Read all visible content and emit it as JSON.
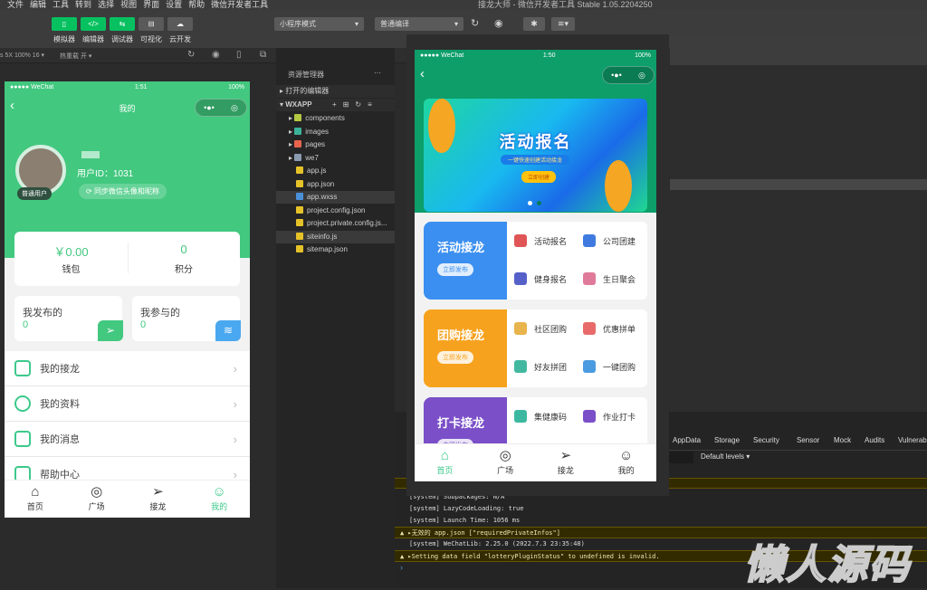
{
  "menubar": {
    "items": [
      "文件",
      "编辑",
      "工具",
      "转到",
      "选择",
      "视图",
      "界面",
      "设置",
      "帮助",
      "微信开发者工具"
    ],
    "title": "接龙大师 - 微信开发者工具 Stable 1.05.2204250"
  },
  "toolbar": {
    "buttons": [
      {
        "label": "模拟器",
        "glyph": "▯"
      },
      {
        "label": "编辑器",
        "glyph": "</>"
      },
      {
        "label": "调试器",
        "glyph": "⇆"
      },
      {
        "label": "可视化",
        "glyph": "⊟"
      },
      {
        "label": "云开发",
        "glyph": "☁"
      }
    ],
    "mode": "小程序模式",
    "compile": "普通编译"
  },
  "simbar": {
    "device": "s 5X 100% 16 ▾",
    "hotreload": "热重载 开 ▾"
  },
  "left_phone": {
    "status": {
      "carrier": "●●●●● WeChat",
      "time": "1:51",
      "battery": "100%"
    },
    "title": "我的",
    "capsule_more": "•●•",
    "capsule_close": "◎",
    "user_id": "用户ID：1031",
    "badge": "普通用户",
    "sync": "同步微信头像和昵称",
    "wallet_value": "￥0.00",
    "wallet_label": "钱包",
    "points_value": "0",
    "points_label": "积分",
    "published_label": "我发布的",
    "published_value": "0",
    "joined_label": "我参与的",
    "joined_value": "0",
    "menu": [
      {
        "label": "我的接龙"
      },
      {
        "label": "我的资料"
      },
      {
        "label": "我的消息"
      },
      {
        "label": "帮助中心"
      }
    ],
    "tabs": [
      {
        "label": "首页",
        "icon": "⌂"
      },
      {
        "label": "广场",
        "icon": "◎"
      },
      {
        "label": "接龙",
        "icon": "➢"
      },
      {
        "label": "我的",
        "icon": "☺"
      }
    ]
  },
  "explorer": {
    "title": "资源管理器",
    "more": "···",
    "open_editors": "打开的编辑器",
    "project": "WXAPP",
    "files": [
      {
        "name": "components",
        "type": "folder",
        "color": "#b5c842"
      },
      {
        "name": "images",
        "type": "folder",
        "color": "#3bb39a"
      },
      {
        "name": "pages",
        "type": "folder",
        "color": "#e8644c"
      },
      {
        "name": "we7",
        "type": "folder",
        "color": "#8a9bb0"
      },
      {
        "name": "app.js",
        "type": "js",
        "color": "#e6c229"
      },
      {
        "name": "app.json",
        "type": "json",
        "color": "#e6c229"
      },
      {
        "name": "app.wxss",
        "type": "css",
        "color": "#4a90d9"
      },
      {
        "name": "project.config.json",
        "type": "json",
        "color": "#e6c229"
      },
      {
        "name": "project.private.config.js...",
        "type": "json",
        "color": "#e6c229"
      },
      {
        "name": "siteinfo.js",
        "type": "js",
        "color": "#e6c229"
      },
      {
        "name": "sitemap.json",
        "type": "json",
        "color": "#e6c229"
      }
    ]
  },
  "right_phone": {
    "status": {
      "carrier": "●●●●● WeChat",
      "time": "1:50",
      "battery": "100%"
    },
    "capsule_more": "•●•",
    "capsule_close": "◎",
    "banner": {
      "title": "活动报名",
      "subtitle": "一键快速创建活动接龙",
      "button": "立即创建"
    },
    "sections": [
      {
        "title": "活动接龙",
        "button": "立即发布",
        "color": "#3b8ff0",
        "items": [
          {
            "label": "活动报名",
            "color": "#e05555"
          },
          {
            "label": "公司团建",
            "color": "#3f7ae0"
          },
          {
            "label": "健身报名",
            "color": "#5561c8"
          },
          {
            "label": "生日聚会",
            "color": "#e07a9a"
          }
        ]
      },
      {
        "title": "团购接龙",
        "button": "立即发布",
        "color": "#f7a21e",
        "items": [
          {
            "label": "社区团购",
            "color": "#e8b44c"
          },
          {
            "label": "优惠拼单",
            "color": "#e86a6a"
          },
          {
            "label": "好友拼团",
            "color": "#43b8a0"
          },
          {
            "label": "一键团购",
            "color": "#4a9be0"
          }
        ]
      },
      {
        "title": "打卡接龙",
        "button": "立即发布",
        "color": "#7a4fc8",
        "items": [
          {
            "label": "集健康码",
            "color": "#3cb8a0"
          },
          {
            "label": "作业打卡",
            "color": "#7a4fc8"
          }
        ]
      }
    ],
    "tabs": [
      {
        "label": "首页",
        "icon": "⌂"
      },
      {
        "label": "广场",
        "icon": "◎"
      },
      {
        "label": "接龙",
        "icon": "➢"
      },
      {
        "label": "我的",
        "icon": "☺"
      }
    ]
  },
  "devtools": {
    "tabs": [
      "AppData",
      "Storage",
      "Security",
      "Sensor",
      "Mock",
      "Audits",
      "Vulnerab"
    ],
    "levels": "Default levels ▾",
    "console": [
      {
        "text": "[system] Subpackages: N/A",
        "warn": false
      },
      {
        "text": "[system] LazyCodeLoading: true",
        "warn": false
      },
      {
        "text": "[system] Launch Time: 1056 ms",
        "warn": false
      },
      {
        "text": "▲ ▸无效的 app.json [\"requiredPrivateInfos\"]",
        "warn": true
      },
      {
        "text": "[system] WeChatLib: 2.25.0 (2022.7.3 23:35:48)",
        "warn": false
      },
      {
        "text": "▲ ▸Setting data field \"lotteryPluginStatus\" to undefined is invalid.",
        "warn": true
      }
    ],
    "prompt": "›"
  },
  "watermark": "懒人源码"
}
